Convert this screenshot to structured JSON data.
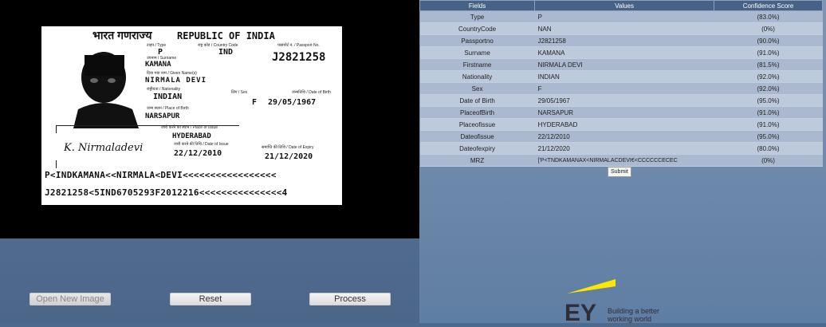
{
  "passport": {
    "title_hindi": "भारत गणराज्य",
    "title_en": "REPUBLIC OF INDIA",
    "type_caption": "टाइप / Type",
    "type": "P",
    "country_caption": "राष्ट्र कोड / Country Code",
    "country": "IND",
    "passport_no_caption": "पासपोर्ट नं. / Passport No.",
    "passport_no": "J2821258",
    "surname_caption": "उपनाम / Surname",
    "surname": "KAMANA",
    "given_caption": "दिया गया नाम / Given Name(s)",
    "given": "NIRMALA DEVI",
    "nationality_caption": "राष्ट्रीयता / Nationality",
    "nationality": "INDIAN",
    "sex_caption": "लिंग / Sex",
    "sex": "F",
    "dob_caption": "जन्मतिथि / Date of Birth",
    "dob": "29/05/1967",
    "pob_caption": "जन्म स्थान / Place of Birth",
    "pob": "NARSAPUR",
    "poi_caption": "जारी करने का स्थान / Place of Issue",
    "poi": "HYDERABAD",
    "doi_caption": "जारी करने की तिथि / Date of Issue",
    "doi": "22/12/2010",
    "doe_caption": "समाप्ति की तिथि / Date of Expiry",
    "doe": "21/12/2020",
    "signature": "K. Nirmaladevi",
    "mrz1": "P<INDKAMANA<<NIRMALA<DEVI<<<<<<<<<<<<<<<<<",
    "mrz2": "J2821258<5IND6705293F2012216<<<<<<<<<<<<<<<4"
  },
  "buttons": {
    "open": "Open New Image",
    "reset": "Reset",
    "process": "Process",
    "submit": "Submit"
  },
  "table": {
    "headers": [
      "Fields",
      "Values",
      "Confidence Score"
    ],
    "rows": [
      {
        "field": "Type",
        "value": "P",
        "score": "(83.0%)"
      },
      {
        "field": "CountryCode",
        "value": "NAN",
        "score": "(0%)"
      },
      {
        "field": "Passportno",
        "value": "J2821258",
        "score": "(90.0%)"
      },
      {
        "field": "Surname",
        "value": "KAMANA",
        "score": "(91.0%)"
      },
      {
        "field": "Firstname",
        "value": "NIRMALA DEVI",
        "score": "(81.5%)"
      },
      {
        "field": "Nationality",
        "value": "INDIAN",
        "score": "(92.0%)"
      },
      {
        "field": "Sex",
        "value": "F",
        "score": "(92.0%)"
      },
      {
        "field": "Date of Birth",
        "value": "29/05/1967",
        "score": "(95.0%)"
      },
      {
        "field": "PlaceofBirth",
        "value": " NARSAPUR",
        "score": "(91.0%)"
      },
      {
        "field": "Placeofissue",
        "value": "HYDERABAD",
        "score": "(91.0%)"
      },
      {
        "field": "Dateofissue",
        "value": "22/12/2010",
        "score": "(95.0%)"
      },
      {
        "field": "Dateofexpiry",
        "value": "21/12/2020",
        "score": "(80.0%)"
      },
      {
        "field": "MRZ",
        "value": "['P<TNDKAMANAX<NIRMALACDEVI€<CCCCCCECEC",
        "score": "(0%)"
      }
    ]
  },
  "logo": {
    "brand": "EY",
    "tagline_1": "Building a better",
    "tagline_2": "working world",
    "accent": "#ffe600"
  }
}
